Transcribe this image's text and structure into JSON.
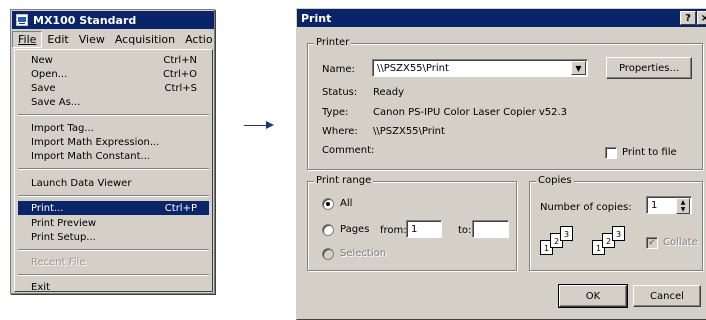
{
  "app": {
    "title": "MX100 Standard",
    "menubar": [
      {
        "label": "File",
        "active": true
      },
      {
        "label": "Edit"
      },
      {
        "label": "View"
      },
      {
        "label": "Acquisition"
      },
      {
        "label": "Actio"
      }
    ],
    "file_menu": [
      {
        "label": "New",
        "shortcut": "Ctrl+N"
      },
      {
        "label": "Open...",
        "shortcut": "Ctrl+O"
      },
      {
        "label": "Save",
        "shortcut": "Ctrl+S"
      },
      {
        "label": "Save As..."
      },
      {
        "label": "Import Tag..."
      },
      {
        "label": "Import Math Expression..."
      },
      {
        "label": "Import Math Constant..."
      },
      {
        "label": "Launch Data Viewer"
      },
      {
        "label": "Print...",
        "shortcut": "Ctrl+P",
        "selected": true
      },
      {
        "label": "Print Preview"
      },
      {
        "label": "Print Setup..."
      },
      {
        "label": "Recent File",
        "disabled": true
      },
      {
        "label": "Exit"
      }
    ]
  },
  "dialog": {
    "title": "Print",
    "help_btn": "?",
    "close_btn": "×",
    "printer": {
      "legend": "Printer",
      "name_label": "Name:",
      "name_value": "\\\\PSZX55\\Print",
      "properties_btn": "Properties...",
      "status_label": "Status:",
      "status_value": "Ready",
      "type_label": "Type:",
      "type_value": "Canon PS-IPU Color Laser Copier v52.3",
      "where_label": "Where:",
      "where_value": "\\\\PSZX55\\Print",
      "comment_label": "Comment:",
      "print_to_file": "Print to file"
    },
    "range": {
      "legend": "Print range",
      "all": "All",
      "pages": "Pages",
      "from_label": "from:",
      "from_value": "1",
      "to_label": "to:",
      "to_value": "",
      "selection": "Selection"
    },
    "copies": {
      "legend": "Copies",
      "number_label": "Number of copies:",
      "number_value": "1",
      "collate": "Collate",
      "page_nums": [
        "1",
        "2",
        "3"
      ]
    },
    "ok_btn": "OK",
    "cancel_btn": "Cancel"
  },
  "colors": {
    "titlebar": "#0a246a",
    "face": "#d4d0c8",
    "arrow": "#1a3a6a"
  }
}
